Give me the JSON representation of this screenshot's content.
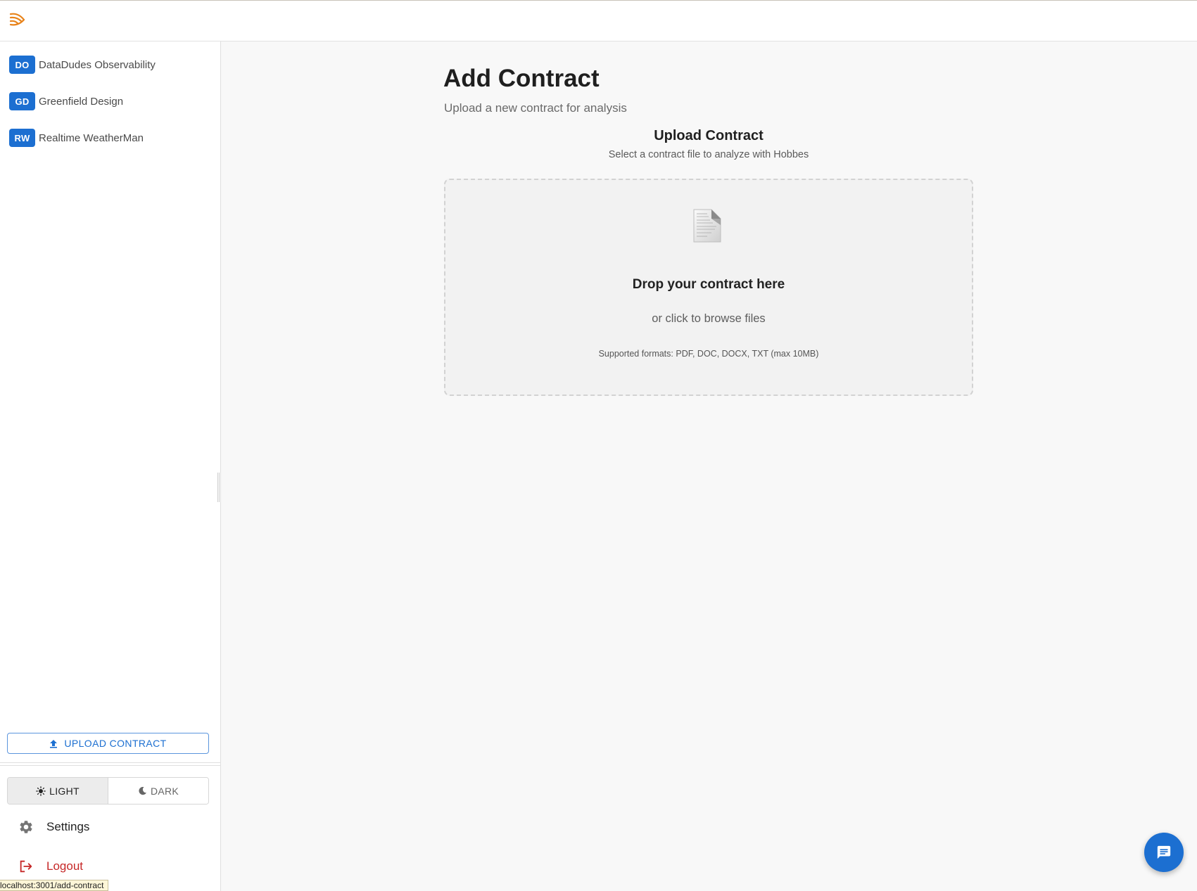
{
  "app": {
    "logo_icon": "signal-waves-logo-icon",
    "accent_color": "#1c6fd1",
    "logo_color": "#e8831a",
    "danger_color": "#c62828"
  },
  "sidebar": {
    "workspaces": [
      {
        "badge": "DO",
        "name": "DataDudes Observability"
      },
      {
        "badge": "GD",
        "name": "Greenfield Design"
      },
      {
        "badge": "RW",
        "name": "Realtime WeatherMan"
      }
    ],
    "upload_button": {
      "label": "UPLOAD CONTRACT",
      "icon": "upload-icon"
    },
    "theme": {
      "light_label": "LIGHT",
      "dark_label": "DARK",
      "selected": "LIGHT"
    },
    "settings_label": "Settings",
    "logout_label": "Logout"
  },
  "main": {
    "title": "Add Contract",
    "subtitle": "Upload a new contract for analysis",
    "card": {
      "title": "Upload Contract",
      "subtitle": "Select a contract file to analyze with Hobbes"
    },
    "dropzone": {
      "icon": "document-icon",
      "title": "Drop your contract here",
      "subtitle": "or click to browse files",
      "formats": "Supported formats: PDF, DOC, DOCX, TXT (max 10MB)"
    }
  },
  "status_url": "localhost:3001/add-contract",
  "chat_fab_icon": "chat-icon"
}
